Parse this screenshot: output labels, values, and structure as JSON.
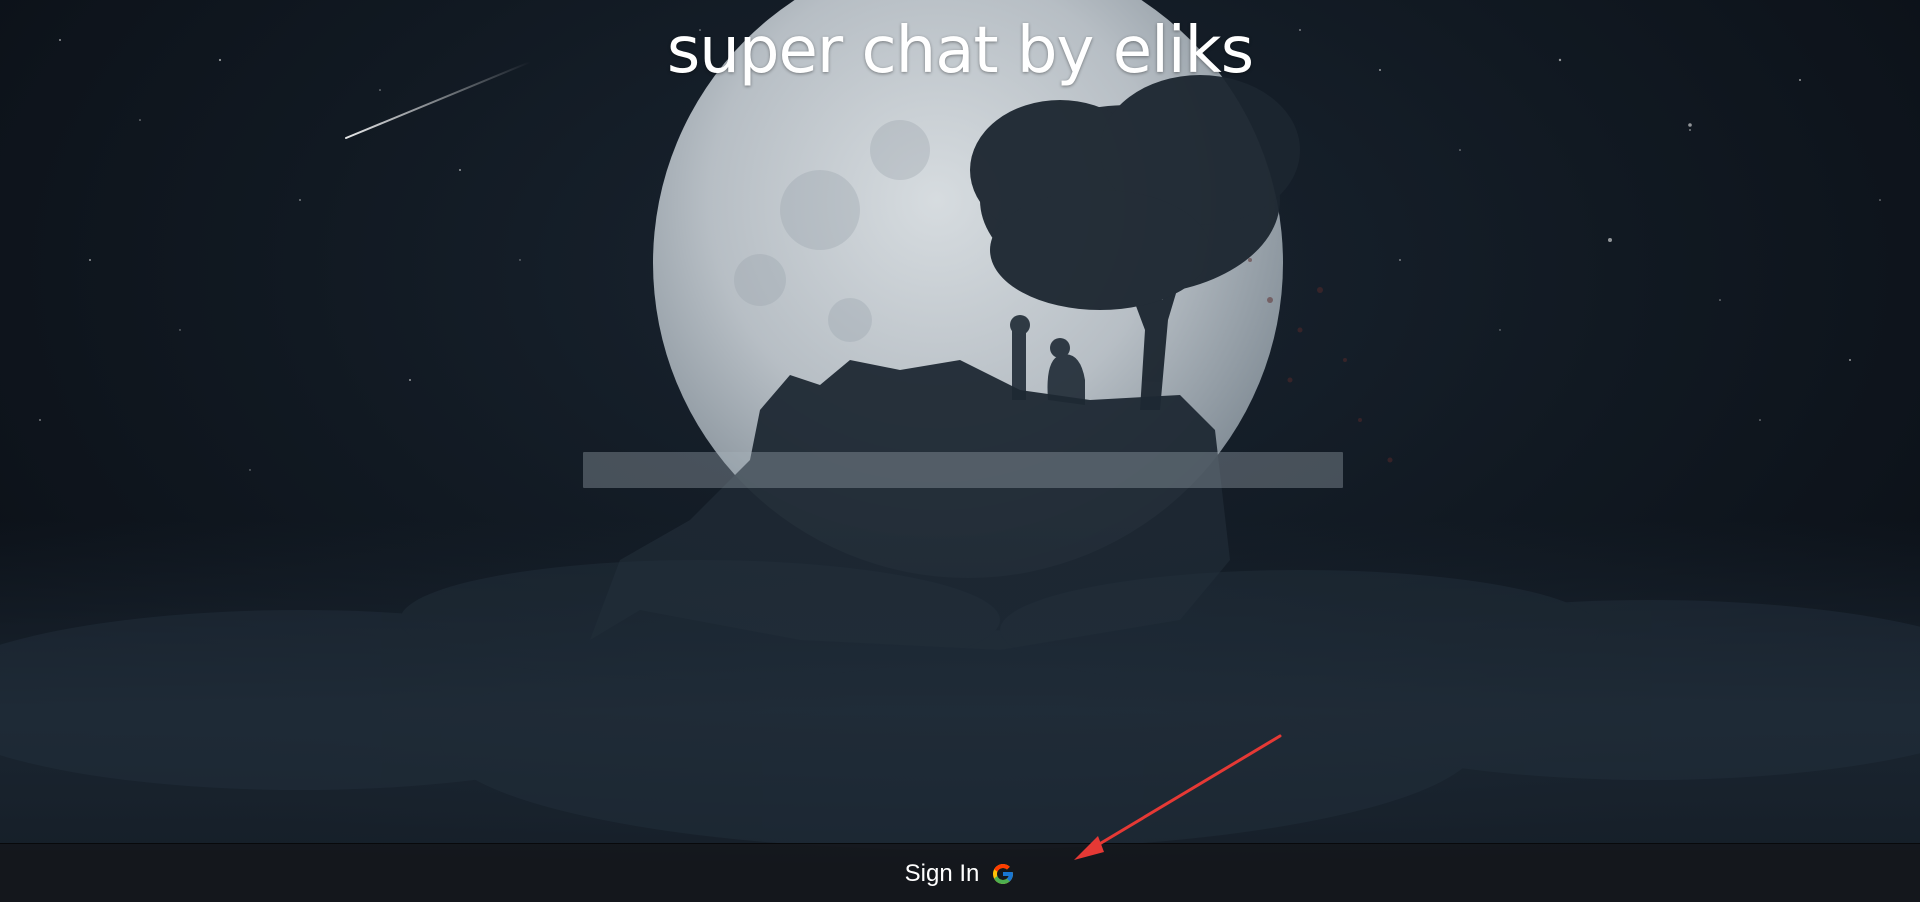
{
  "header": {
    "title": "super chat by eliks"
  },
  "background": {
    "scene": "night-sky-moon-tree-rock-icon"
  },
  "footer": {
    "signin_label": "Sign In",
    "signin_icon": "google-icon"
  },
  "colors": {
    "annotation_arrow": "#e53935",
    "google_blue": "#4285F4",
    "google_red": "#EA4335",
    "google_yellow": "#FBBC05",
    "google_green": "#34A853"
  }
}
